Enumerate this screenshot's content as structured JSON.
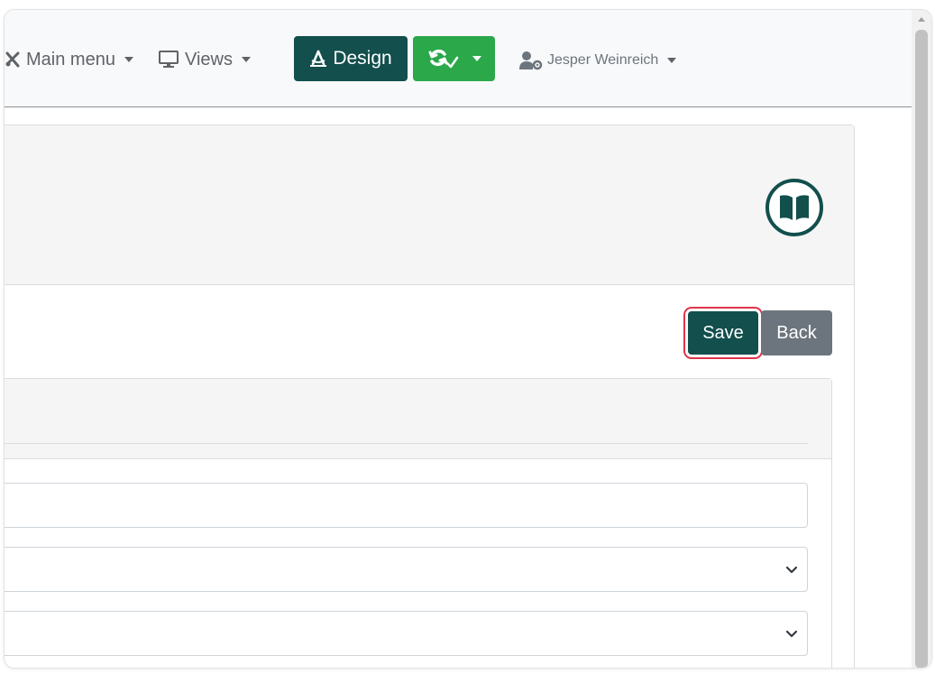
{
  "navbar": {
    "main_menu_label": "Main menu",
    "views_label": "Views",
    "design_label": "Design",
    "user_label": "Jesper Weinreich"
  },
  "content": {
    "save_label": "Save",
    "back_label": "Back"
  },
  "form": {
    "text_field_value": "",
    "select_1_value": "",
    "select_2_value": ""
  },
  "colors": {
    "primary_teal": "#124f4d",
    "sync_green": "#2ba84a",
    "secondary_gray": "#6c757d",
    "focus_ring_red": "#e0344a"
  },
  "icons": {
    "main_menu": "tools-icon",
    "views": "monitor-icon",
    "design": "drafting-compass-icon",
    "sync": "sync-check-icon",
    "user": "user-cog-icon",
    "help": "book-open-icon"
  }
}
